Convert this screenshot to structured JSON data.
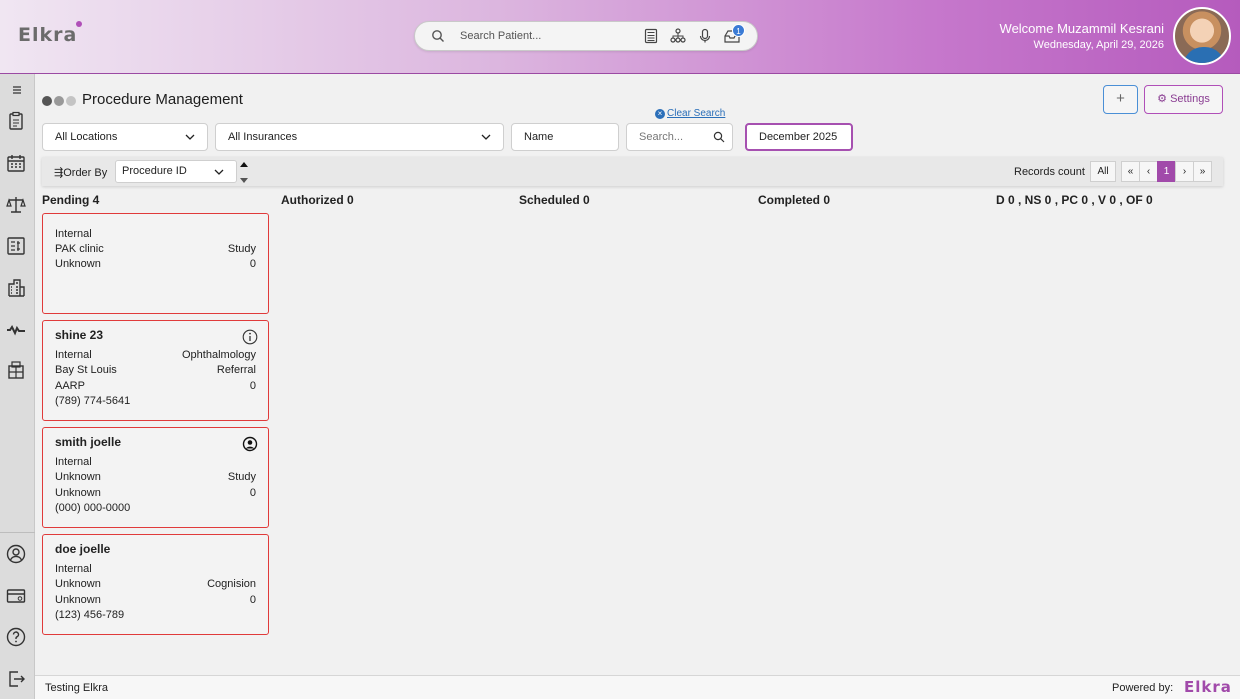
{
  "header": {
    "logo_text": "Elkra",
    "search_placeholder": "Search Patient...",
    "notification_count": "1",
    "welcome_text": "Welcome Muzammil Kesrani",
    "date_text": "Wednesday, April 29, 2026"
  },
  "page": {
    "title": "Procedure Management",
    "add_label": "+",
    "settings_label": "Settings",
    "clear_search_label": "Clear Search"
  },
  "filters": {
    "locations": "All Locations",
    "insurances": "All Insurances",
    "name": "Name",
    "search_placeholder": "Search...",
    "date": "December 2025"
  },
  "order": {
    "label": "Order By",
    "selected": "Procedure ID",
    "records_label": "Records count",
    "all_label": "All",
    "first": "«",
    "prev": "‹",
    "page": "1",
    "next": "›",
    "last": "»"
  },
  "columns": [
    {
      "label": "Pending 4"
    },
    {
      "label": "Authorized 0"
    },
    {
      "label": "Scheduled 0"
    },
    {
      "label": "Completed 0"
    },
    {
      "label": "D 0 , NS 0 , PC 0 , V 0 , OF 0"
    }
  ],
  "cards": [
    {
      "name": "",
      "r1_left": "Internal",
      "r1_right": "",
      "r2_left": "PAK clinic",
      "r2_right": "Study",
      "r3_left": "Unknown",
      "r3_right": "0",
      "phone": ""
    },
    {
      "name": "shine 23",
      "r1_left": "Internal",
      "r1_right": "Ophthalmology",
      "r2_left": "Bay St Louis",
      "r2_right": "Referral",
      "r3_left": "AARP",
      "r3_right": "0",
      "phone": "(789) 774-5641"
    },
    {
      "name": "smith joelle",
      "r1_left": "Internal",
      "r1_right": "",
      "r2_left": "Unknown",
      "r2_right": "Study",
      "r3_left": "Unknown",
      "r3_right": "0",
      "phone": "(000) 000-0000"
    },
    {
      "name": "doe joelle",
      "r1_left": "Internal",
      "r1_right": "",
      "r2_left": "Unknown",
      "r2_right": "Cognision",
      "r3_left": "Unknown",
      "r3_right": "0",
      "phone": "(123) 456-789"
    }
  ],
  "footer": {
    "left_text": "Testing Elkra",
    "powered_label": "Powered by:",
    "logo_text": "Elkra"
  },
  "colors": {
    "accent": "#a14aaa",
    "card_border": "#e03a3a"
  }
}
